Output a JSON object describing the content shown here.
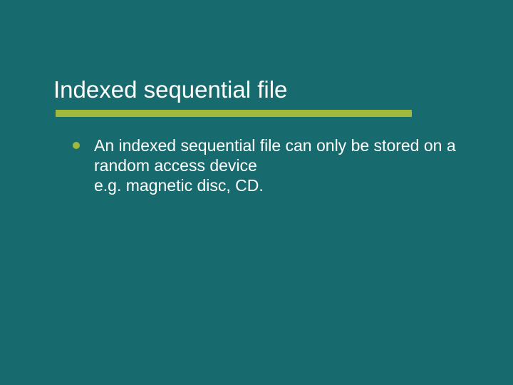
{
  "slide": {
    "title": "Indexed sequential file",
    "bullets": [
      {
        "text": "An indexed sequential file can only be stored on a random access device\ne.g. magnetic disc, CD."
      }
    ]
  },
  "colors": {
    "background": "#176a6e",
    "accent": "#a0b83b",
    "text": "#ffffff"
  }
}
